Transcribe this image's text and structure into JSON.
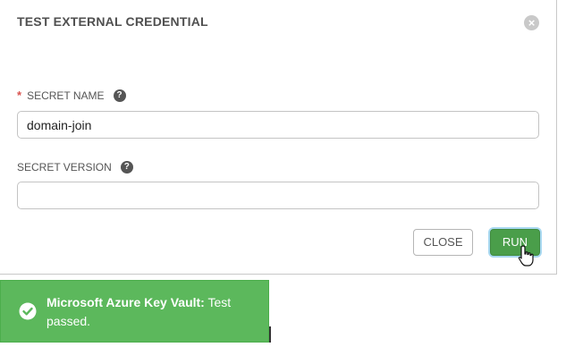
{
  "modal": {
    "title": "TEST EXTERNAL CREDENTIAL",
    "close_icon": "close-circle-icon"
  },
  "fields": {
    "secret_name": {
      "required_marker": "*",
      "label": "SECRET NAME",
      "help_icon": "question-circle-icon",
      "value": "domain-join"
    },
    "secret_version": {
      "label": "SECRET VERSION",
      "help_icon": "question-circle-icon",
      "value": ""
    }
  },
  "buttons": {
    "close_label": "CLOSE",
    "run_label": "RUN"
  },
  "toast": {
    "icon": "check-circle-icon",
    "title": "Microsoft Azure Key Vault:",
    "message": "Test passed.",
    "color": "#5cb85c"
  },
  "colors": {
    "run_button": "#4a9e4a",
    "required": "#d9534f"
  }
}
